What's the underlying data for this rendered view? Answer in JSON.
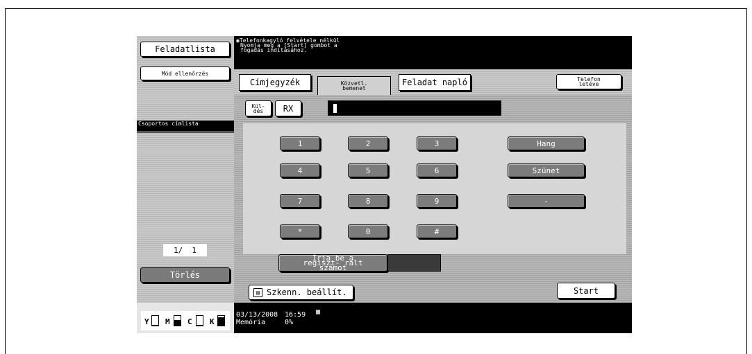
{
  "left_panel": {
    "job_list": "Feladatlista",
    "mode_check": "Mód ellenőrzés",
    "group_list": "Csoportos címlista",
    "page_counter": "1/  1",
    "delete": "Törlés",
    "toner": [
      {
        "label": "Y",
        "level": 0.1
      },
      {
        "label": "M",
        "level": 0.55
      },
      {
        "label": "C",
        "level": 0.1
      },
      {
        "label": "K",
        "level": 0.85
      }
    ]
  },
  "message": {
    "line1": "Telefonkagyló felvétele nélkül",
    "line2": "Nyomja meg a [Start] gombot a",
    "line3": "fogadás indításához."
  },
  "tabs": {
    "address_book": "Címjegyzék",
    "direct_input": "Közvetl. bemenet",
    "job_log": "Feladat napló",
    "hang_up": "Telefon letéve"
  },
  "mode": {
    "send": "Kül- dés",
    "rx": "RX",
    "number_field_value": ""
  },
  "keypad": {
    "keys": [
      "1",
      "2",
      "3",
      "4",
      "5",
      "6",
      "7",
      "8",
      "9",
      "*",
      "0",
      "#"
    ],
    "tone": "Hang",
    "pause": "Szünet",
    "dash": "-"
  },
  "registered": {
    "label": "Írja be a regiszt- rált számot",
    "value": ""
  },
  "actions": {
    "scan_settings": "Szkenn. beállít.",
    "start": "Start"
  },
  "status": {
    "date": "03/13/2008",
    "time": "16:59",
    "memory_label": "Memória",
    "memory_value": "0%"
  }
}
